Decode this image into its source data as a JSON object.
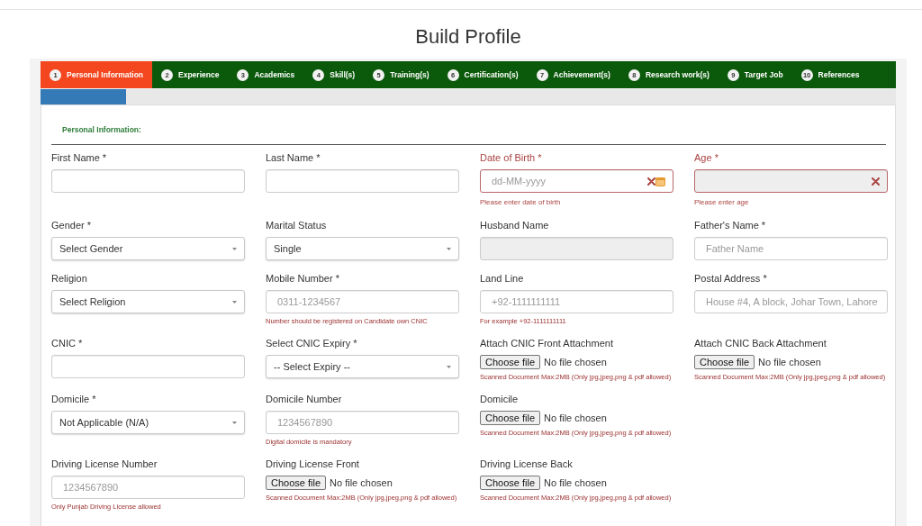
{
  "page": {
    "title": "Build Profile"
  },
  "tabs": [
    {
      "number": "1",
      "label": "Personal Information",
      "selected": true
    },
    {
      "number": "2",
      "label": "Experience",
      "selected": false
    },
    {
      "number": "3",
      "label": "Academics",
      "selected": false
    },
    {
      "number": "4",
      "label": "Skill(s)",
      "selected": false
    },
    {
      "number": "5",
      "label": "Training(s)",
      "selected": false
    },
    {
      "number": "6",
      "label": "Certification(s)",
      "selected": false
    },
    {
      "number": "7",
      "label": "Achievement(s)",
      "selected": false
    },
    {
      "number": "8",
      "label": "Research work(s)",
      "selected": false
    },
    {
      "number": "9",
      "label": "Target Job",
      "selected": false
    },
    {
      "number": "10",
      "label": "References",
      "selected": false
    }
  ],
  "progress": {
    "level": 0.1
  },
  "section": {
    "title": "Personal Information:"
  },
  "rows": [
    {
      "fields": [
        {
          "kind": "text",
          "label": "First Name *",
          "disabled": false
        },
        {
          "kind": "text",
          "label": "Last Name *",
          "disabled": false
        },
        {
          "kind": "date",
          "label": "Date of Birth *",
          "placeholder": "dd-MM-yyyy",
          "disabled": false,
          "error": "Please enter date of birth"
        },
        {
          "kind": "text",
          "label": "Age *",
          "disabled": true,
          "error": "Please enter age"
        }
      ]
    },
    {
      "fields": [
        {
          "kind": "select",
          "label": "Gender *",
          "value": "Select Gender",
          "disabled": false
        },
        {
          "kind": "select",
          "label": "Marital Status",
          "value": "Single",
          "disabled": false
        },
        {
          "kind": "text",
          "label": "Husband Name",
          "disabled": true
        },
        {
          "kind": "text",
          "label": "Father's Name *",
          "placeholder": "Father Name",
          "disabled": false
        }
      ]
    },
    {
      "fields": [
        {
          "kind": "select",
          "label": "Religion",
          "value": "Select Religion",
          "disabled": false
        },
        {
          "kind": "text",
          "label": "Mobile Number *",
          "placeholder": "0311-1234567",
          "disabled": false,
          "note": "Number should be registered on Candidate own CNIC"
        },
        {
          "kind": "text",
          "label": "Land Line",
          "placeholder": "+92-1111111111",
          "disabled": false,
          "note": "For example +92-1111111111"
        },
        {
          "kind": "text",
          "label": "Postal Address *",
          "placeholder": "House #4, A block, Johar Town, Lahore",
          "disabled": false
        }
      ]
    },
    {
      "fields": [
        {
          "kind": "text",
          "label": "CNIC *",
          "disabled": false
        },
        {
          "kind": "select",
          "label": "Select CNIC Expiry *",
          "value": "-- Select Expiry --",
          "disabled": false
        },
        {
          "kind": "file",
          "label": "Attach CNIC Front Attachment",
          "button": "Choose file",
          "status": "No file chosen",
          "disabled": false,
          "note": "Scanned Document Max:2MB (Only jpg,jpeg,png & pdf allowed)"
        },
        {
          "kind": "file",
          "label": "Attach CNIC Back Attachment",
          "button": "Choose file",
          "status": "No file chosen",
          "disabled": false,
          "note": "Scanned Document Max:2MB (Only jpg,jpeg,png & pdf allowed)"
        }
      ]
    },
    {
      "fields": [
        {
          "kind": "select",
          "label": "Domicile *",
          "value": "Not Applicable (N/A)",
          "disabled": false
        },
        {
          "kind": "text",
          "label": "Domicile Number",
          "placeholder": "1234567890",
          "disabled": false,
          "note": "Digital domicile is mandatory"
        },
        {
          "kind": "file",
          "label": "Domicile",
          "button": "Choose file",
          "status": "No file chosen",
          "disabled": false,
          "note": "Scanned Document Max:2MB (Only jpg,jpeg,png & pdf allowed)"
        }
      ]
    },
    {
      "fields": [
        {
          "kind": "text",
          "label": "Driving License Number",
          "placeholder": "1234567890",
          "disabled": false,
          "note": "Only Punjab Driving License allowed"
        },
        {
          "kind": "file",
          "label": "Driving License Front",
          "button": "Choose file",
          "status": "No file chosen",
          "disabled": false,
          "note": "Scanned Document Max:2MB (Only jpg,jpeg,png & pdf allowed)"
        },
        {
          "kind": "file",
          "label": "Driving License Back",
          "button": "Choose file",
          "status": "No file chosen",
          "disabled": false,
          "note": "Scanned Document Max:2MB (Only jpg,jpeg,png & pdf allowed)"
        }
      ]
    }
  ]
}
